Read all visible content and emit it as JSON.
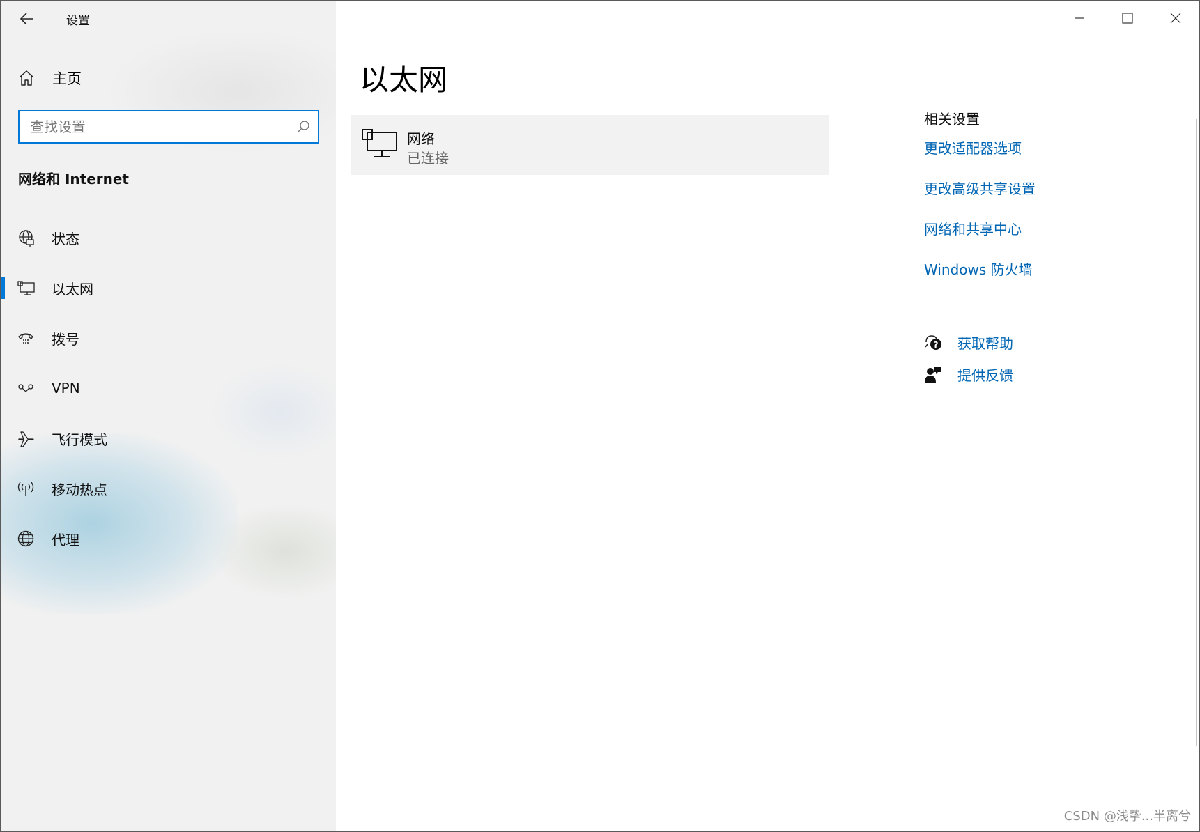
{
  "window": {
    "app_title": "设置",
    "minimize_icon": "minimize-icon",
    "maximize_icon": "maximize-icon",
    "close_icon": "close-icon"
  },
  "sidebar": {
    "home_label": "主页",
    "search_placeholder": "查找设置",
    "section_title": "网络和 Internet",
    "items": [
      {
        "label": "状态",
        "icon": "globe-status-icon"
      },
      {
        "label": "以太网",
        "icon": "ethernet-icon",
        "active": true
      },
      {
        "label": "拨号",
        "icon": "dialup-icon"
      },
      {
        "label": "VPN",
        "icon": "vpn-icon"
      },
      {
        "label": "飞行模式",
        "icon": "airplane-icon"
      },
      {
        "label": "移动热点",
        "icon": "hotspot-icon"
      },
      {
        "label": "代理",
        "icon": "globe-icon"
      }
    ]
  },
  "main": {
    "page_title": "以太网",
    "network": {
      "name": "网络",
      "status": "已连接",
      "icon": "ethernet-icon"
    }
  },
  "related": {
    "heading": "相关设置",
    "links": [
      "更改适配器选项",
      "更改高级共享设置",
      "网络和共享中心",
      "Windows 防火墙"
    ]
  },
  "help": {
    "get_help": "获取帮助",
    "feedback": "提供反馈"
  },
  "watermark": "CSDN @浅挚...半离兮",
  "colors": {
    "accent": "#0078d7",
    "link": "#0066b4"
  }
}
